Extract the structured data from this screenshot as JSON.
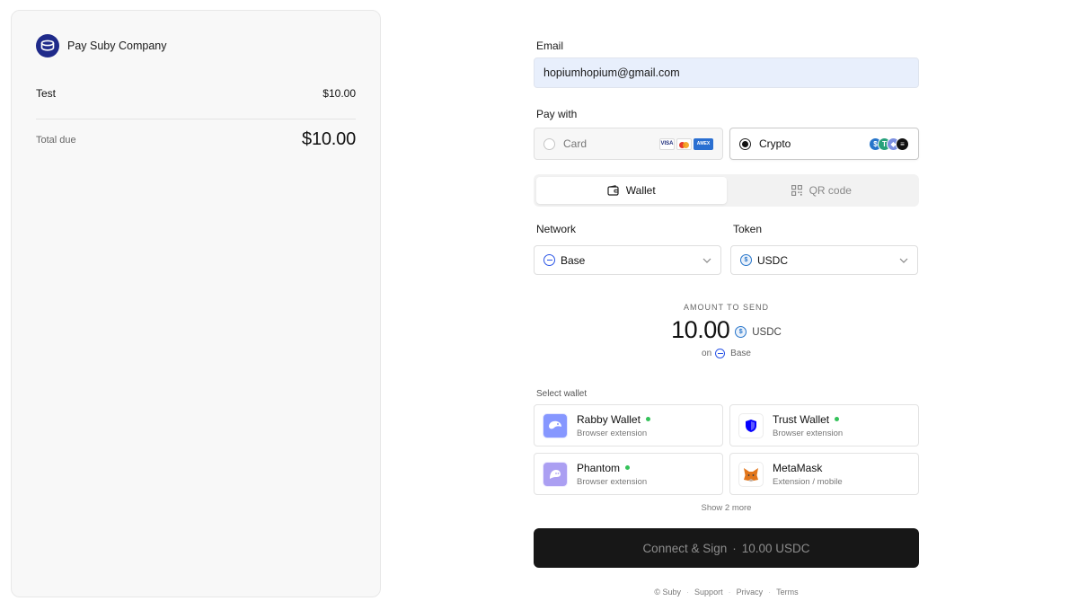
{
  "summary": {
    "merchant_name": "Pay Suby Company",
    "line_item": {
      "name": "Test",
      "price": "$10.00"
    },
    "total_label": "Total due",
    "total_value": "$10.00"
  },
  "form": {
    "email": {
      "label": "Email",
      "value": "hopiumhopium@gmail.com"
    },
    "pay_with": {
      "label": "Pay with",
      "options": [
        {
          "label": "Card",
          "selected": false,
          "icons": [
            "visa-icon",
            "mastercard-icon",
            "amex-icon"
          ]
        },
        {
          "label": "Crypto",
          "selected": true,
          "icons": [
            "usdc-icon",
            "tether-icon",
            "ethereum-icon",
            "solana-icon"
          ]
        }
      ]
    },
    "tabs": [
      {
        "label": "Wallet",
        "active": true,
        "icon": "wallet-icon"
      },
      {
        "label": "QR code",
        "active": false,
        "icon": "qr-code-icon"
      }
    ],
    "network": {
      "label": "Network",
      "value": "Base"
    },
    "token": {
      "label": "Token",
      "value": "USDC"
    },
    "amount": {
      "label": "AMOUNT TO SEND",
      "value": "10.00",
      "unit": "USDC",
      "on_label": "on",
      "network": "Base"
    },
    "wallets": {
      "label": "Select wallet",
      "items": [
        {
          "name": "Rabby Wallet",
          "subtitle": "Browser extension",
          "detected": true,
          "icon": "rabby-icon"
        },
        {
          "name": "Trust Wallet",
          "subtitle": "Browser extension",
          "detected": true,
          "icon": "trust-shield-icon"
        },
        {
          "name": "Phantom",
          "subtitle": "Browser extension",
          "detected": true,
          "icon": "phantom-icon"
        },
        {
          "name": "MetaMask",
          "subtitle": "Extension / mobile",
          "detected": false,
          "icon": "metamask-fox-icon"
        }
      ],
      "show_more": "Show 2 more"
    },
    "connect_button": {
      "label": "Connect & Sign",
      "separator": "·",
      "amount": "10.00 USDC"
    }
  },
  "footer": {
    "copyright": "© Suby",
    "separator": "·",
    "links": [
      "Support",
      "Privacy",
      "Terms"
    ]
  },
  "colors": {
    "merchant_logo": "#1f2a8a",
    "email_bg": "#e8effc",
    "button_bg": "#171717",
    "detected_dot": "#34c25a",
    "base_blue": "#2b55e6",
    "usdc_blue": "#2775ca"
  }
}
